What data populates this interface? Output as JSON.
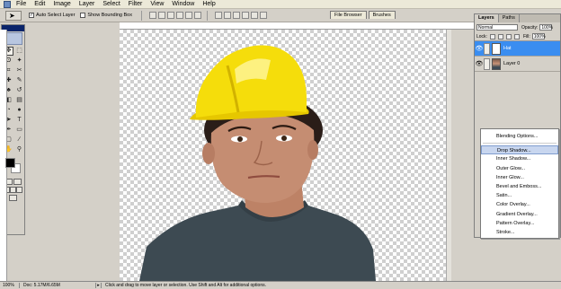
{
  "menubar": {
    "items": [
      "File",
      "Edit",
      "Image",
      "Layer",
      "Select",
      "Filter",
      "View",
      "Window",
      "Help"
    ]
  },
  "options_bar": {
    "auto_select_label": "Auto Select Layer",
    "auto_select_checked": true,
    "bounding_box_label": "Show Bounding Box",
    "bounding_box_checked": false
  },
  "palette_well": {
    "tabs": [
      "File Browser",
      "Brushes"
    ]
  },
  "tools": {
    "items": [
      "move-tool",
      "marquee-tool",
      "lasso-tool",
      "magic-wand-tool",
      "crop-tool",
      "slice-tool",
      "healing-brush-tool",
      "brush-tool",
      "clone-stamp-tool",
      "history-brush-tool",
      "eraser-tool",
      "gradient-tool",
      "blur-tool",
      "dodge-tool",
      "path-selection-tool",
      "type-tool",
      "pen-tool",
      "shape-tool",
      "notes-tool",
      "eyedropper-tool",
      "hand-tool",
      "zoom-tool"
    ],
    "icons": [
      "✥",
      "⬚",
      "ʘ",
      "✦",
      "⌗",
      "✂",
      "✚",
      "✎",
      "♣",
      "↺",
      "◧",
      "▤",
      "◔",
      "●",
      "➤",
      "T",
      "✒",
      "▭",
      "▢",
      "∕",
      "✋",
      "⚲"
    ],
    "foreground_color": "#000000",
    "background_color": "#ffffff"
  },
  "layers_panel": {
    "tabs": [
      "Layers",
      "Paths"
    ],
    "blend_mode": "Normal",
    "opacity_label": "Opacity:",
    "opacity_value": "100%",
    "lock_label": "Lock:",
    "fill_label": "Fill:",
    "fill_value": "100%",
    "layers": [
      {
        "name": "Hat",
        "visible": true,
        "selected": true
      },
      {
        "name": "Layer 0",
        "visible": true,
        "selected": false
      }
    ]
  },
  "context_menu": {
    "items": [
      "Blending Options...",
      "Drop Shadow...",
      "Inner Shadow...",
      "Outer Glow...",
      "Inner Glow...",
      "Bevel and Emboss...",
      "Satin...",
      "Color Overlay...",
      "Gradient Overlay...",
      "Pattern Overlay...",
      "Stroke..."
    ],
    "highlighted_index": 1
  },
  "statusbar": {
    "zoom": "100%",
    "doc_size": "Doc: 5.17M/6.65M",
    "hint": "Click and drag to move layer or selection. Use Shift and Alt for additional options."
  },
  "colors": {
    "accent_selected_layer": "#3a8df0",
    "hat_yellow": "#f5dd0b",
    "shirt": "#3d4a52"
  }
}
